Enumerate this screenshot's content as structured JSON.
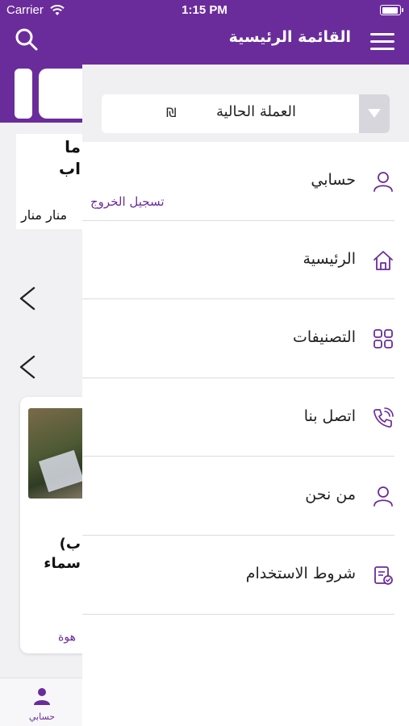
{
  "status_bar": {
    "carrier": "Carrier",
    "time": "1:15 PM"
  },
  "colors": {
    "primary": "#6a2c9b",
    "drawer_bg": "#ffffff",
    "section_bg": "#f0f0f2",
    "divider": "#dcdce0"
  },
  "drawer": {
    "title": "القائمة الرئيسية",
    "menu_icon": "hamburger-icon",
    "currency": {
      "label": "العملة الحالية",
      "symbol": "₪"
    },
    "items": [
      {
        "label": "حسابي",
        "icon": "user-icon",
        "sub_action": "تسجيل الخروج"
      },
      {
        "label": "الرئيسية",
        "icon": "home-icon"
      },
      {
        "label": "التصنيفات",
        "icon": "grid-icon"
      },
      {
        "label": "اتصل بنا",
        "icon": "phone-icon"
      },
      {
        "label": "من نحن",
        "icon": "user-icon"
      },
      {
        "label": "شروط الاستخدام",
        "icon": "document-icon"
      }
    ]
  },
  "background": {
    "card1": {
      "line1": "ما",
      "line2": "اب",
      "author": "منار منار"
    },
    "card2": {
      "line1": "ب)",
      "line2": "سماء",
      "author": "هوة"
    },
    "tabbar": {
      "label": "حسابي"
    }
  }
}
